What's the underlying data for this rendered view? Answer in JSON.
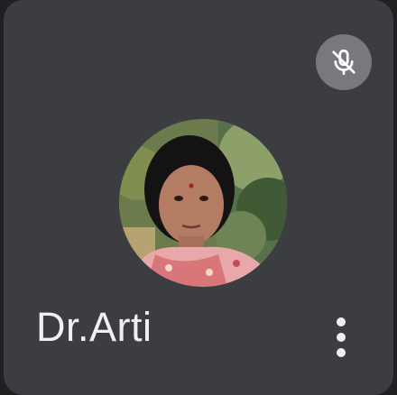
{
  "participant": {
    "name": "Dr.Arti",
    "mic_status_icon": "mic-off-icon",
    "menu_icon": "more-vert-icon"
  },
  "colors": {
    "tile_background": "#3c3d40",
    "badge_background": "#77797e",
    "text": "#eef0f2"
  }
}
